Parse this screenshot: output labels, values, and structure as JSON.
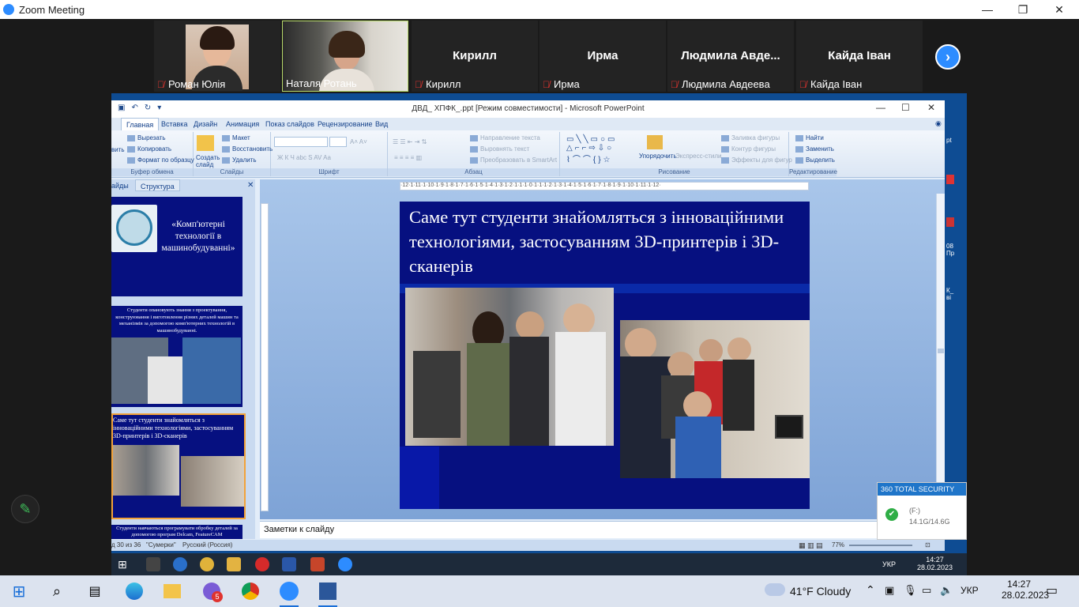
{
  "zoom": {
    "window_title": "Zoom Meeting",
    "controls": {
      "minimize": "—",
      "restore": "❐",
      "close": "✕"
    }
  },
  "participants": [
    {
      "display_name": "Роман Юлія",
      "big_name": "",
      "muted": true,
      "video": true
    },
    {
      "display_name": "Наталя Ротань",
      "big_name": "",
      "muted": false,
      "video": true,
      "active_speaker": true
    },
    {
      "display_name": "Кирилл",
      "big_name": "Кирилл",
      "muted": true,
      "video": false
    },
    {
      "display_name": "Ирма",
      "big_name": "Ирма",
      "muted": true,
      "video": false
    },
    {
      "display_name": "Людмила Авдеева",
      "big_name": "Людмила  Авде...",
      "muted": true,
      "video": false
    },
    {
      "display_name": "Кайда Іван",
      "big_name": "Кайда Іван",
      "muted": true,
      "video": false
    }
  ],
  "next_page_icon": "chevron-right-icon",
  "ppt": {
    "window_title": "ДВД_ ХПФК_.ppt [Режим совместимости] - Microsoft PowerPoint",
    "tabs": [
      "Главная",
      "Вставка",
      "Дизайн",
      "Анимация",
      "Показ слайдов",
      "Рецензирование",
      "Вид"
    ],
    "selected_tab": "Главная",
    "ribbon": {
      "clipboard": {
        "label": "Буфер обмена",
        "cut": "Вырезать",
        "copy": "Копировать",
        "format": "Формат по образцу",
        "paste": "вить"
      },
      "slides": {
        "label": "Слайды",
        "create": "Создать",
        "create2": "слайд",
        "layout": "Макет",
        "reset": "Восстановить",
        "delete": "Удалить"
      },
      "font": {
        "label": "Шрифт"
      },
      "paragraph": {
        "label": "Абзац",
        "direction": "Направление текста",
        "align": "Выровнять текст",
        "smartart": "Преобразовать в SmartArt"
      },
      "drawing": {
        "label": "Рисование",
        "arrange": "Упорядочить",
        "quick_styles": "Экспресс-стили",
        "fill": "Заливка фигуры",
        "outline": "Контур фигуры",
        "effects": "Эффекты для фигур"
      },
      "editing": {
        "label": "Редактирование",
        "find": "Найти",
        "replace": "Заменить",
        "select": "Выделить"
      }
    },
    "pane_tabs": [
      "айды",
      "Структура"
    ],
    "thumbnails": [
      {
        "title": "«Комп'ютерні технології в машинобудуванні»"
      },
      {
        "text": "Студенти опановують знання з проектування, конструювання і виготовлення різних деталей машин та механізмів за допомогою комп'ютерних технологій в машинобудуванні."
      },
      {
        "text": "Саме тут студенти знайомляться з інноваційними технологіями, застосуванням 3D-принтерів і 3D-сканерів",
        "selected": true
      },
      {
        "text": "Студенти навчаються програмувати обробку деталей за допомогою програм Delcam, FeatureCAM"
      }
    ],
    "slide_title": "Саме тут студенти знайомляться з інноваційними технологіями, застосуванням 3D-принтерів і 3D-сканерів",
    "ruler_text": "·12·1·11·1·10·1·9·1·8·1·7·1·6·1·5·1·4·1·3·1·2·1·1·1·0·1·1·1·2·1·3·1·4·1·5·1·6·1·7·1·8·1·9·1·10·1·11·1·12·",
    "notes_placeholder": "Заметки к слайду",
    "status": {
      "slide": "д 30 из 36",
      "theme": "\"Сумерки\"",
      "lang": "Русский (Россия)",
      "zoom": "77%"
    }
  },
  "security_popup": {
    "title": "360 TOTAL SECURITY",
    "drive": "(F:)",
    "usage": "14.1G/14.6G"
  },
  "inner_taskbar": {
    "lang": "УКР",
    "time": "14:27",
    "date": "28.02.2023"
  },
  "taskbar": {
    "weather": "41°F  Cloudy",
    "lang": "УКР",
    "time": "14:27",
    "date": "28.02.2023",
    "viber_badge": "5"
  },
  "colors": {
    "slide_bg": "#061080",
    "zoom_blue": "#2d8cff",
    "mute_red": "#e0332f"
  }
}
